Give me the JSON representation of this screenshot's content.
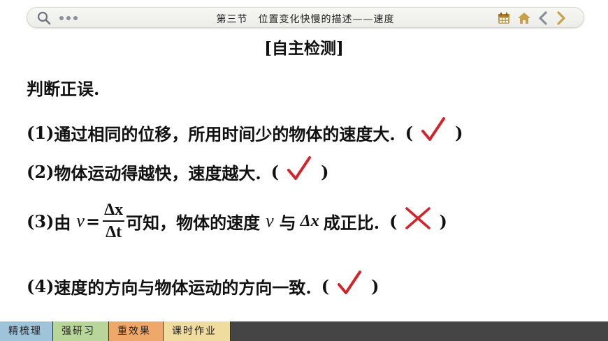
{
  "header": {
    "title": "第三节　位置变化快慢的描述——速度",
    "icons": [
      "search-icon",
      "more-dots-icon",
      "calendar-icon",
      "home-icon",
      "chevron-left-icon",
      "chevron-right-icon"
    ],
    "accent_color": "#c8a04a"
  },
  "section_heading": "[自主检测]",
  "intro": "判断正误.",
  "items": [
    {
      "label": "(1)",
      "text": "通过相同的位移，所用时间少的物体的速度大.",
      "open": "(",
      "close": ")",
      "answer": "check"
    },
    {
      "label": "(2)",
      "text": "物体运动得越快，速度越大.",
      "open": "(",
      "close": ")",
      "answer": "check"
    },
    {
      "label": "(3)",
      "pre": "由",
      "var_v": "v",
      "eq": "=",
      "frac_num": "Δx",
      "frac_den": "Δt",
      "post": "可知，物体的速度",
      "var_v2": "v",
      "mid": "与",
      "delta_x": "Δx",
      "end": "成正比.",
      "open": "(",
      "close": ")",
      "answer": "cross"
    },
    {
      "label": "(4)",
      "text": "速度的方向与物体运动的方向一致.",
      "open": "(",
      "close": ")",
      "answer": "check"
    }
  ],
  "answer_color": "#d0252b",
  "bottom_tabs": [
    {
      "label": "精梳理",
      "color": "#9fc3d9"
    },
    {
      "label": "强研习",
      "color": "#b9d69a"
    },
    {
      "label": "重效果",
      "color": "#f0a76a"
    },
    {
      "label": "课时作业",
      "color": "#f0dc9e"
    }
  ]
}
